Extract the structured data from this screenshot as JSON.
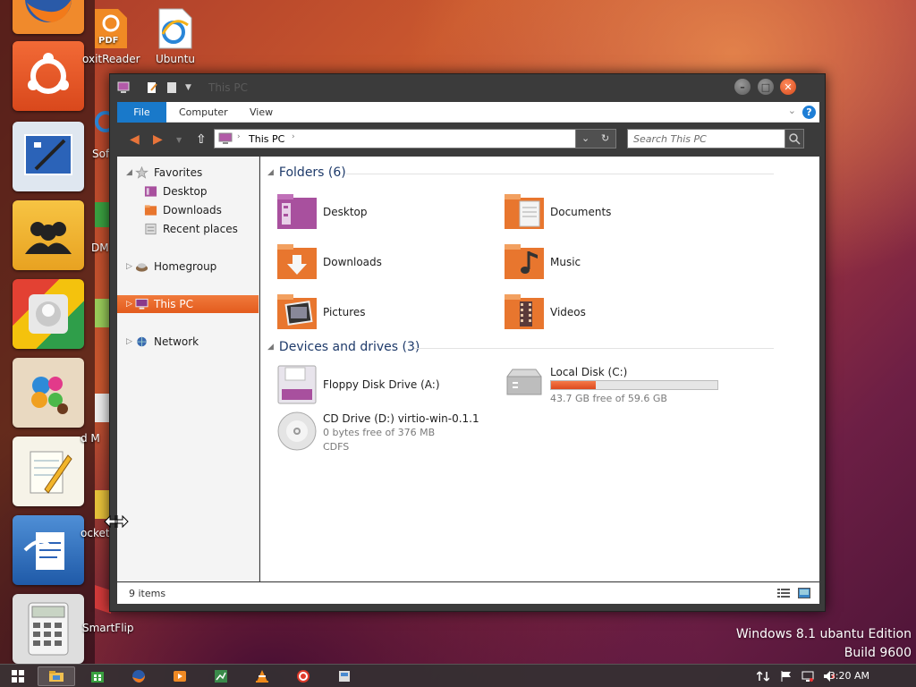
{
  "desktop": {
    "icons": [
      {
        "label": "oxitReader"
      },
      {
        "label": "Ubuntu"
      },
      {
        "label": "Sof"
      },
      {
        "label": "DM"
      },
      {
        "label": "d M"
      },
      {
        "label": "ocket"
      },
      {
        "label": "SmartFlip"
      }
    ],
    "watermark": {
      "line1": "Windows 8.1 ubantu Edition",
      "line2": "Build 9600"
    }
  },
  "dock": {
    "items": [
      "firefox-icon",
      "ubuntu-icon",
      "paint-icon",
      "contacts-icon",
      "chrome-icon",
      "splash-paint-icon",
      "notepad-icon",
      "writer-icon",
      "calculator-icon"
    ]
  },
  "window": {
    "title": "This PC",
    "ribbon": {
      "tabs": [
        "File",
        "Computer",
        "View"
      ],
      "help": "?"
    },
    "address": {
      "crumb": "This PC",
      "search_placeholder": "Search This PC"
    },
    "nav": {
      "favorites": "Favorites",
      "desktop": "Desktop",
      "downloads": "Downloads",
      "recent": "Recent places",
      "homegroup": "Homegroup",
      "thispc": "This PC",
      "network": "Network"
    },
    "folders_header": "Folders (6)",
    "folders": [
      "Desktop",
      "Documents",
      "Downloads",
      "Music",
      "Pictures",
      "Videos"
    ],
    "devices_header": "Devices and drives (3)",
    "drives": {
      "floppy": {
        "name": "Floppy Disk Drive (A:)"
      },
      "local": {
        "name": "Local Disk (C:)",
        "free": "43.7 GB free of 59.6 GB",
        "used_fraction": 0.267
      },
      "cd": {
        "name": "CD Drive (D:) virtio-win-0.1.1",
        "free": "0 bytes free of 376 MB",
        "fs": "CDFS"
      }
    },
    "status": "9 items"
  },
  "taskbar": {
    "clock": "3:20 AM"
  },
  "colors": {
    "accent": "#e35b1d",
    "ribbon_blue": "#1979ca"
  }
}
